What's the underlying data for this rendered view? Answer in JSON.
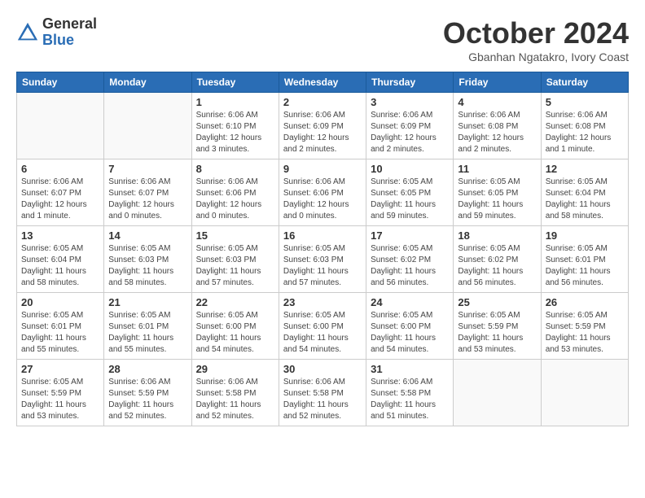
{
  "header": {
    "logo": {
      "text_general": "General",
      "text_blue": "Blue"
    },
    "title": "October 2024",
    "subtitle": "Gbanhan Ngatakro, Ivory Coast"
  },
  "calendar": {
    "days_of_week": [
      "Sunday",
      "Monday",
      "Tuesday",
      "Wednesday",
      "Thursday",
      "Friday",
      "Saturday"
    ],
    "weeks": [
      [
        {
          "day": "",
          "info": ""
        },
        {
          "day": "",
          "info": ""
        },
        {
          "day": "1",
          "info": "Sunrise: 6:06 AM\nSunset: 6:10 PM\nDaylight: 12 hours\nand 3 minutes."
        },
        {
          "day": "2",
          "info": "Sunrise: 6:06 AM\nSunset: 6:09 PM\nDaylight: 12 hours\nand 2 minutes."
        },
        {
          "day": "3",
          "info": "Sunrise: 6:06 AM\nSunset: 6:09 PM\nDaylight: 12 hours\nand 2 minutes."
        },
        {
          "day": "4",
          "info": "Sunrise: 6:06 AM\nSunset: 6:08 PM\nDaylight: 12 hours\nand 2 minutes."
        },
        {
          "day": "5",
          "info": "Sunrise: 6:06 AM\nSunset: 6:08 PM\nDaylight: 12 hours\nand 1 minute."
        }
      ],
      [
        {
          "day": "6",
          "info": "Sunrise: 6:06 AM\nSunset: 6:07 PM\nDaylight: 12 hours\nand 1 minute."
        },
        {
          "day": "7",
          "info": "Sunrise: 6:06 AM\nSunset: 6:07 PM\nDaylight: 12 hours\nand 0 minutes."
        },
        {
          "day": "8",
          "info": "Sunrise: 6:06 AM\nSunset: 6:06 PM\nDaylight: 12 hours\nand 0 minutes."
        },
        {
          "day": "9",
          "info": "Sunrise: 6:06 AM\nSunset: 6:06 PM\nDaylight: 12 hours\nand 0 minutes."
        },
        {
          "day": "10",
          "info": "Sunrise: 6:05 AM\nSunset: 6:05 PM\nDaylight: 11 hours\nand 59 minutes."
        },
        {
          "day": "11",
          "info": "Sunrise: 6:05 AM\nSunset: 6:05 PM\nDaylight: 11 hours\nand 59 minutes."
        },
        {
          "day": "12",
          "info": "Sunrise: 6:05 AM\nSunset: 6:04 PM\nDaylight: 11 hours\nand 58 minutes."
        }
      ],
      [
        {
          "day": "13",
          "info": "Sunrise: 6:05 AM\nSunset: 6:04 PM\nDaylight: 11 hours\nand 58 minutes."
        },
        {
          "day": "14",
          "info": "Sunrise: 6:05 AM\nSunset: 6:03 PM\nDaylight: 11 hours\nand 58 minutes."
        },
        {
          "day": "15",
          "info": "Sunrise: 6:05 AM\nSunset: 6:03 PM\nDaylight: 11 hours\nand 57 minutes."
        },
        {
          "day": "16",
          "info": "Sunrise: 6:05 AM\nSunset: 6:03 PM\nDaylight: 11 hours\nand 57 minutes."
        },
        {
          "day": "17",
          "info": "Sunrise: 6:05 AM\nSunset: 6:02 PM\nDaylight: 11 hours\nand 56 minutes."
        },
        {
          "day": "18",
          "info": "Sunrise: 6:05 AM\nSunset: 6:02 PM\nDaylight: 11 hours\nand 56 minutes."
        },
        {
          "day": "19",
          "info": "Sunrise: 6:05 AM\nSunset: 6:01 PM\nDaylight: 11 hours\nand 56 minutes."
        }
      ],
      [
        {
          "day": "20",
          "info": "Sunrise: 6:05 AM\nSunset: 6:01 PM\nDaylight: 11 hours\nand 55 minutes."
        },
        {
          "day": "21",
          "info": "Sunrise: 6:05 AM\nSunset: 6:01 PM\nDaylight: 11 hours\nand 55 minutes."
        },
        {
          "day": "22",
          "info": "Sunrise: 6:05 AM\nSunset: 6:00 PM\nDaylight: 11 hours\nand 54 minutes."
        },
        {
          "day": "23",
          "info": "Sunrise: 6:05 AM\nSunset: 6:00 PM\nDaylight: 11 hours\nand 54 minutes."
        },
        {
          "day": "24",
          "info": "Sunrise: 6:05 AM\nSunset: 6:00 PM\nDaylight: 11 hours\nand 54 minutes."
        },
        {
          "day": "25",
          "info": "Sunrise: 6:05 AM\nSunset: 5:59 PM\nDaylight: 11 hours\nand 53 minutes."
        },
        {
          "day": "26",
          "info": "Sunrise: 6:05 AM\nSunset: 5:59 PM\nDaylight: 11 hours\nand 53 minutes."
        }
      ],
      [
        {
          "day": "27",
          "info": "Sunrise: 6:05 AM\nSunset: 5:59 PM\nDaylight: 11 hours\nand 53 minutes."
        },
        {
          "day": "28",
          "info": "Sunrise: 6:06 AM\nSunset: 5:59 PM\nDaylight: 11 hours\nand 52 minutes."
        },
        {
          "day": "29",
          "info": "Sunrise: 6:06 AM\nSunset: 5:58 PM\nDaylight: 11 hours\nand 52 minutes."
        },
        {
          "day": "30",
          "info": "Sunrise: 6:06 AM\nSunset: 5:58 PM\nDaylight: 11 hours\nand 52 minutes."
        },
        {
          "day": "31",
          "info": "Sunrise: 6:06 AM\nSunset: 5:58 PM\nDaylight: 11 hours\nand 51 minutes."
        },
        {
          "day": "",
          "info": ""
        },
        {
          "day": "",
          "info": ""
        }
      ]
    ]
  }
}
